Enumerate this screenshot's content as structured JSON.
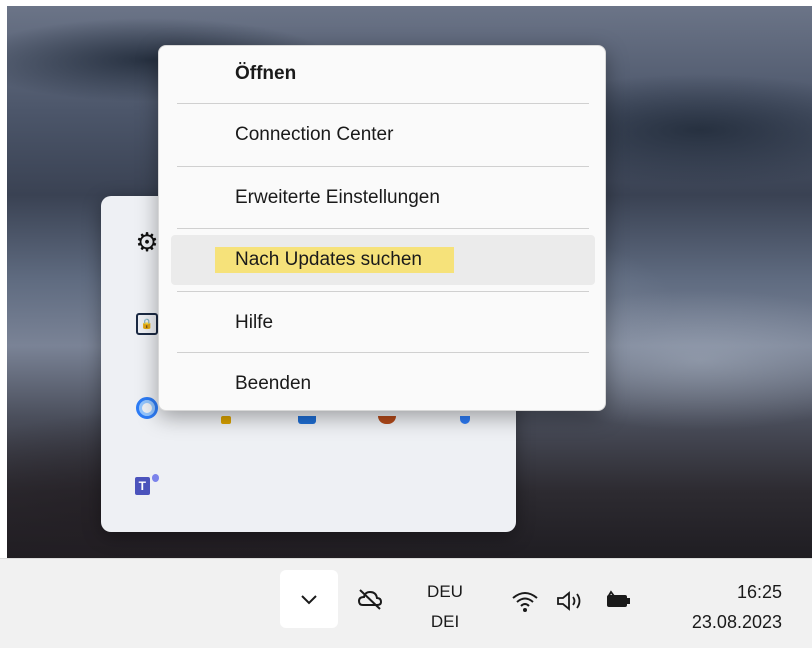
{
  "context_menu": {
    "items": [
      {
        "label": "Öffnen"
      },
      {
        "label": "Connection Center"
      },
      {
        "label": "Erweiterte Einstellungen"
      },
      {
        "label": "Nach Updates suchen"
      },
      {
        "label": "Hilfe"
      },
      {
        "label": "Beenden"
      }
    ],
    "highlight_color": "#f6e27a"
  },
  "tray_flyout": {
    "icons": [
      "gear-icon",
      "vpn-lock-icon",
      "blue-swirl-icon",
      "yellow-app-icon",
      "blue-app-icon",
      "orange-app-icon",
      "blue-circle-icon",
      "teams-icon"
    ]
  },
  "taskbar": {
    "language_top": "DEU",
    "language_bottom": "DEI",
    "time": "16:25",
    "date": "23.08.2023",
    "icons": [
      "chevron-down-icon",
      "cloud-off-icon",
      "wifi-icon",
      "volume-icon",
      "battery-icon"
    ]
  }
}
